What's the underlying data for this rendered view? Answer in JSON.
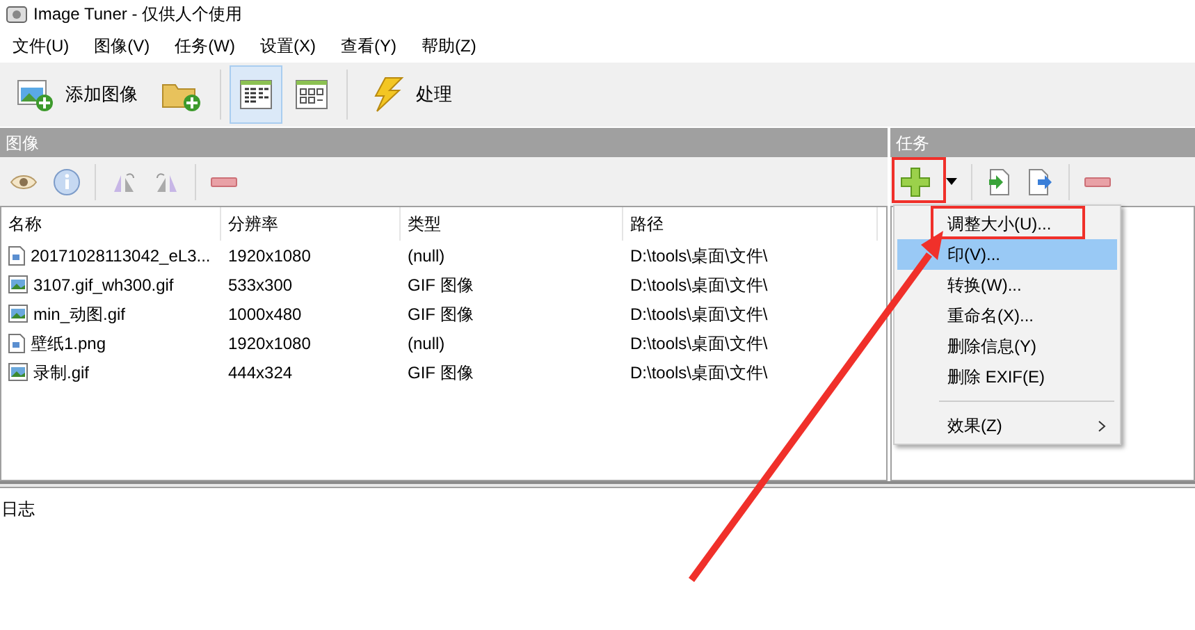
{
  "window": {
    "title": "Image Tuner - 仅供人个使用"
  },
  "menu": [
    "文件(U)",
    "图像(V)",
    "任务(W)",
    "设置(X)",
    "查看(Y)",
    "帮助(Z)"
  ],
  "toolbar": [
    {
      "kind": "add-image",
      "label": "添加图像"
    },
    {
      "kind": "add-folder"
    },
    {
      "kind": "sep"
    },
    {
      "kind": "list-view",
      "selected": true
    },
    {
      "kind": "thumb-view",
      "selected": false
    },
    {
      "kind": "sep"
    },
    {
      "kind": "process",
      "label": "处理"
    }
  ],
  "images_panel": {
    "title": "图像",
    "tools": [
      {
        "kind": "eye"
      },
      {
        "kind": "info"
      },
      {
        "kind": "sep"
      },
      {
        "kind": "flip-left"
      },
      {
        "kind": "flip-right"
      },
      {
        "kind": "sep"
      },
      {
        "kind": "remove"
      }
    ],
    "columns": [
      "名称",
      "分辨率",
      "类型",
      "路径"
    ],
    "rows": [
      {
        "kind": "doc",
        "cells": [
          "20171028113042_eL3...",
          "1920x1080",
          "(null)",
          "D:\\tools\\桌面\\文件\\"
        ]
      },
      {
        "kind": "pic",
        "cells": [
          "3107.gif_wh300.gif",
          "533x300",
          "GIF 图像",
          "D:\\tools\\桌面\\文件\\"
        ]
      },
      {
        "kind": "pic",
        "cells": [
          "min_动图.gif",
          "1000x480",
          "GIF 图像",
          "D:\\tools\\桌面\\文件\\"
        ]
      },
      {
        "kind": "doc",
        "cells": [
          "壁纸1.png",
          "1920x1080",
          "(null)",
          "D:\\tools\\桌面\\文件\\"
        ]
      },
      {
        "kind": "pic",
        "cells": [
          "录制.gif",
          "444x324",
          "GIF 图像",
          "D:\\tools\\桌面\\文件\\"
        ]
      }
    ]
  },
  "tasks_panel": {
    "title": "任务",
    "tools": [
      {
        "kind": "add"
      },
      {
        "kind": "caret"
      },
      {
        "kind": "sep"
      },
      {
        "kind": "import"
      },
      {
        "kind": "export"
      },
      {
        "kind": "sep"
      },
      {
        "kind": "remove"
      }
    ]
  },
  "task_menu": [
    {
      "kind": "item",
      "label": "调整大小(U)...",
      "selected": false
    },
    {
      "kind": "item",
      "label": "印(V)...",
      "selected": true
    },
    {
      "kind": "item",
      "label": "转换(W)...",
      "selected": false
    },
    {
      "kind": "item",
      "label": "重命名(X)...",
      "selected": false
    },
    {
      "kind": "item",
      "label": "删除信息(Y)",
      "selected": false
    },
    {
      "kind": "item",
      "label": "删除 EXIF(E)",
      "selected": false
    },
    {
      "kind": "sep"
    },
    {
      "kind": "submenu",
      "label": "效果(Z)",
      "selected": false
    }
  ],
  "log": {
    "title": "日志"
  }
}
